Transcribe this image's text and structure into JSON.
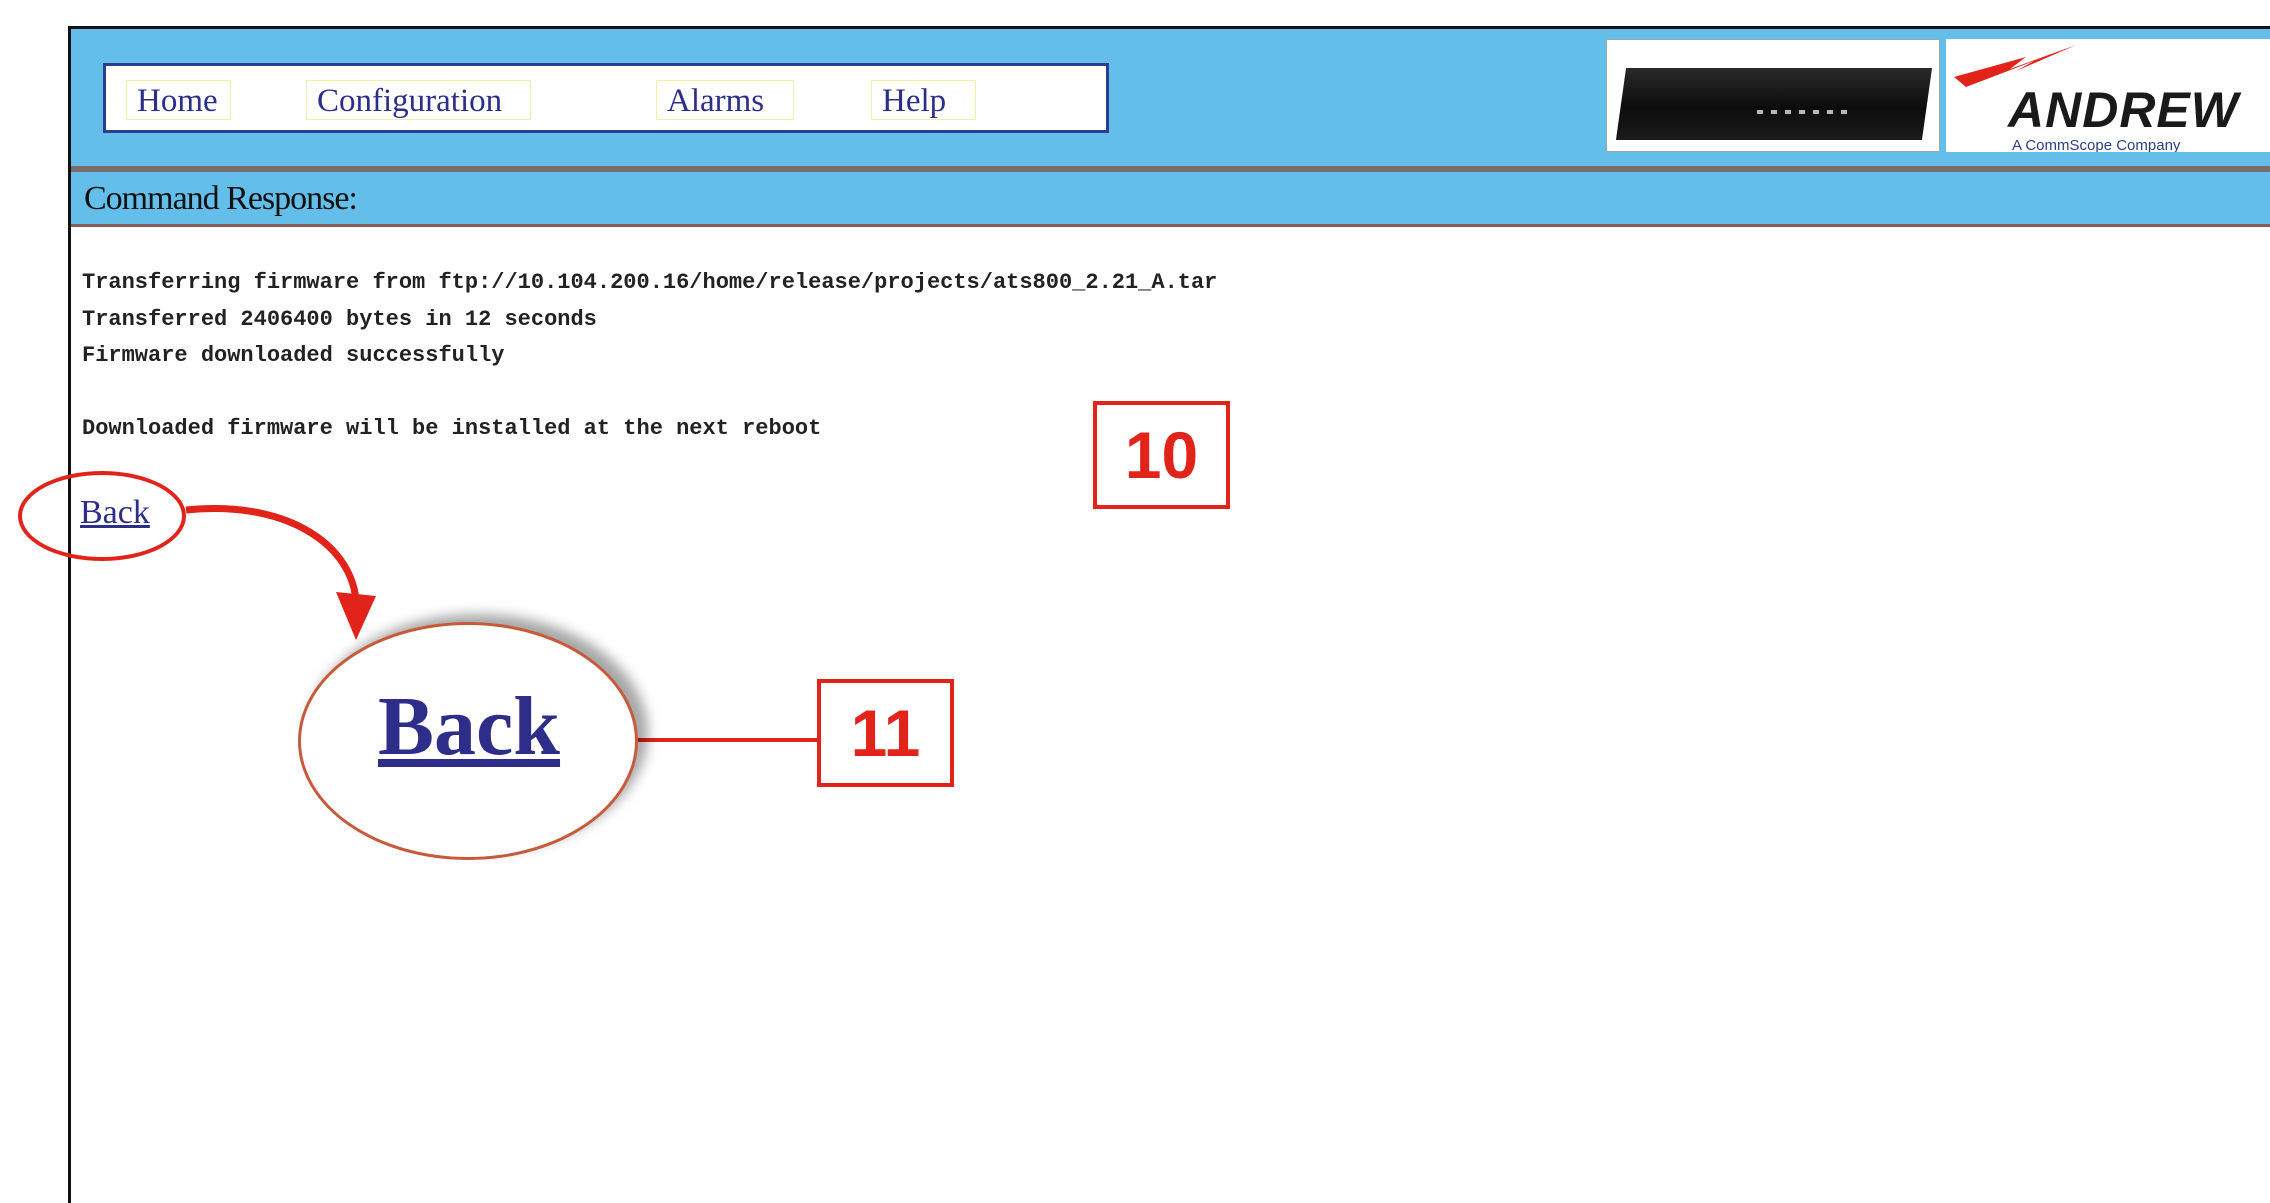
{
  "nav": {
    "items": [
      {
        "label": "Home"
      },
      {
        "label": "Configuration"
      },
      {
        "label": "Alarms"
      },
      {
        "label": "Help"
      }
    ]
  },
  "logo": {
    "brand": "ANDREW",
    "subtitle": "A CommScope Company"
  },
  "subheader": {
    "title": "Command Response:"
  },
  "response": {
    "lines": [
      "Transferring firmware from ftp://10.104.200.16/home/release/projects/ats800_2.21_A.tar",
      "Transferred 2406400 bytes in 12 seconds",
      "Firmware downloaded successfully",
      "Downloaded firmware will be installed at the next reboot"
    ]
  },
  "back_link": {
    "label": "Back"
  },
  "annotations": {
    "zoom_label": "Back",
    "step_10": "10",
    "step_11": "11",
    "accent_color": "#e2231a"
  },
  "colors": {
    "header_bg": "#63bfea",
    "link": "#2b2f8a"
  }
}
